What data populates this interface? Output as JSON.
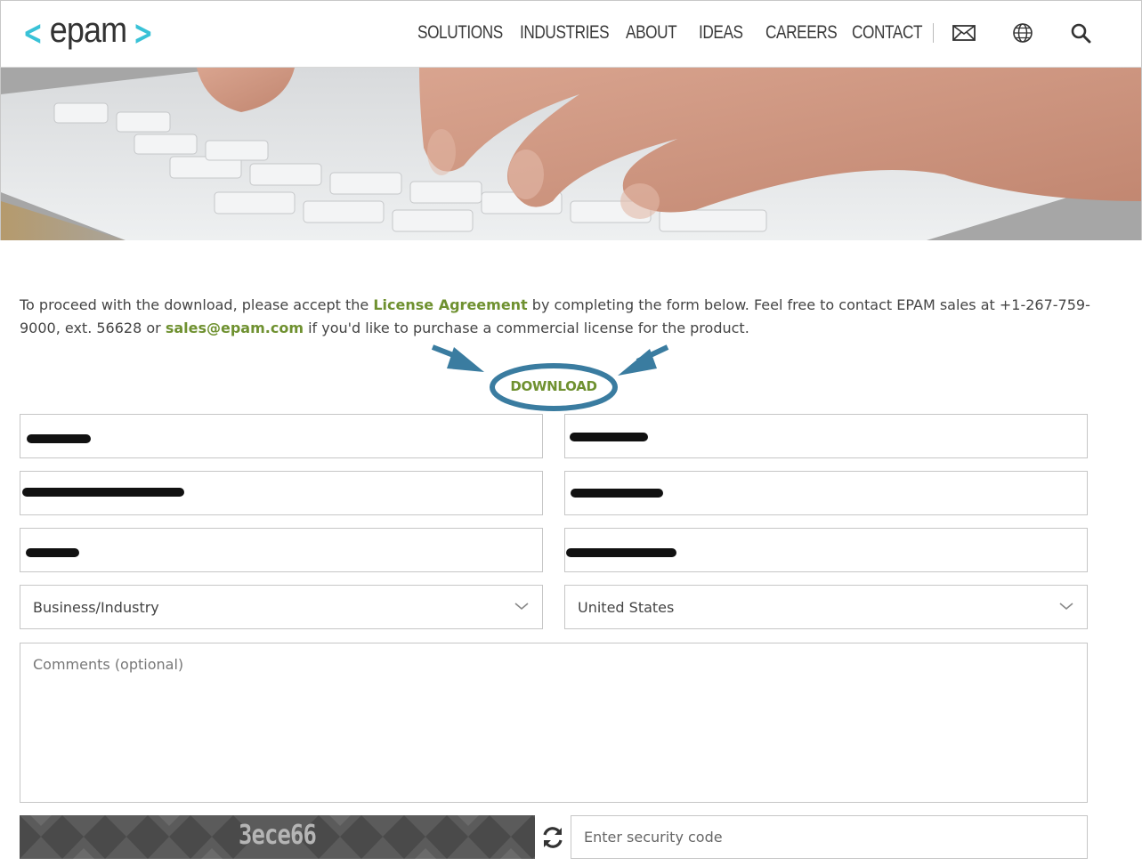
{
  "header": {
    "logo_left": "<",
    "logo_text": "epam",
    "logo_right": ">",
    "nav": [
      "SOLUTIONS",
      "INDUSTRIES",
      "ABOUT",
      "IDEAS",
      "CAREERS",
      "CONTACT"
    ],
    "icons": [
      "mail-icon",
      "globe-icon",
      "search-icon"
    ]
  },
  "intro": {
    "part1": "To proceed with the download, please accept the ",
    "license_link": "License Agreement",
    "part2": " by completing the form below. Feel free to contact EPAM sales at +1-267-759-9000, ext. 56628 or ",
    "email_link": "sales@epam.com",
    "part3": " if you'd like to purchase a commercial license for the product."
  },
  "download_label": "DOWNLOAD",
  "form": {
    "industry_value": "Business/Industry",
    "country_value": "United States",
    "comments_placeholder": "Comments (optional)",
    "security_placeholder": "Enter security code"
  },
  "captcha": {
    "code": "3ece66"
  },
  "colors": {
    "accent_green": "#6f9130",
    "logo_cyan": "#39c2d7",
    "annotation_blue": "#3a7ca0"
  }
}
